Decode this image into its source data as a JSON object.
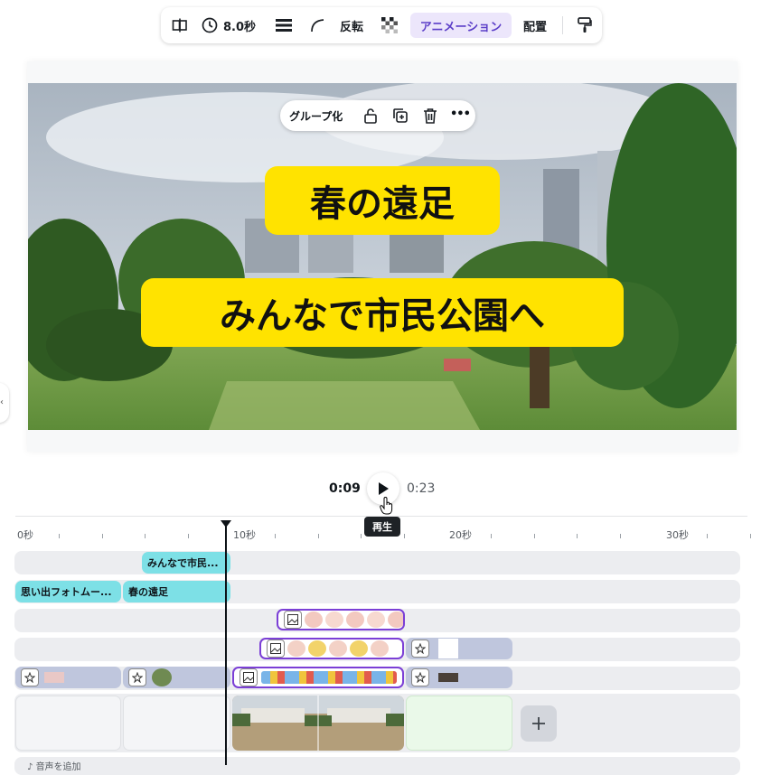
{
  "toolbar": {
    "duration_label": "8.0秒",
    "flip_label": "反転",
    "animation_label": "アニメーション",
    "position_label": "配置"
  },
  "group_bar": {
    "group_label": "グループ化",
    "more_label": "•••"
  },
  "canvas": {
    "title_text": "春の遠足",
    "subtitle_text": "みんなで市民公園へ"
  },
  "playback": {
    "current_time": "0:09",
    "total_time": "0:23",
    "tooltip": "再生"
  },
  "ruler": {
    "labels": [
      "0秒",
      "10秒",
      "20秒",
      "30秒"
    ]
  },
  "timeline": {
    "text_clip_1": "みんなで市民...",
    "text_clip_2": "思い出フォトムー...",
    "text_clip_3": "春の遠足",
    "bottom_hint": "音声を追加"
  },
  "colors": {
    "accent": "#7b3fd6",
    "title_bg": "#ffe300",
    "text_clip": "#7de0e6",
    "image_clip": "#bfc6dd"
  }
}
